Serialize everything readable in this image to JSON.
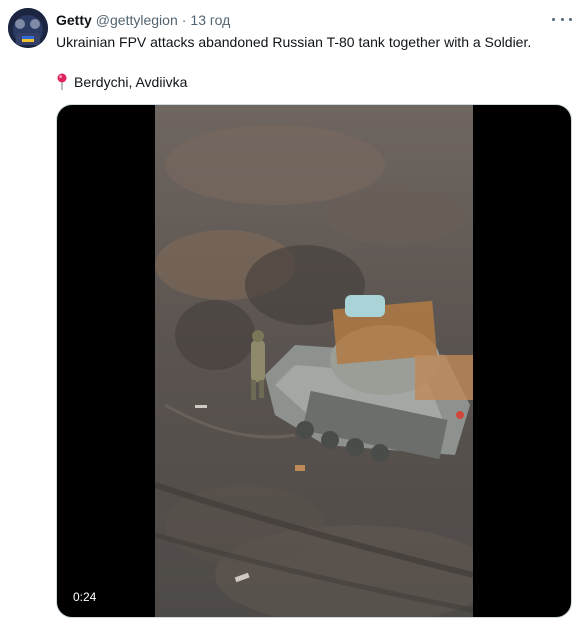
{
  "tweet": {
    "author": {
      "display_name": "Getty",
      "handle": "@gettylegion",
      "avatar_icon": "avatar"
    },
    "separator": "·",
    "timestamp": "13 год",
    "text": "Ukrainian FPV attacks abandoned Russian T-80 tank together with a Soldier.",
    "location": {
      "icon": "pin-icon",
      "label": "Berdychi, Avdiivka"
    },
    "media": {
      "type": "video",
      "duration": "0:24"
    }
  },
  "colors": {
    "text_primary": "#0f1419",
    "text_secondary": "#536471",
    "pin_red": "#e0245e"
  }
}
